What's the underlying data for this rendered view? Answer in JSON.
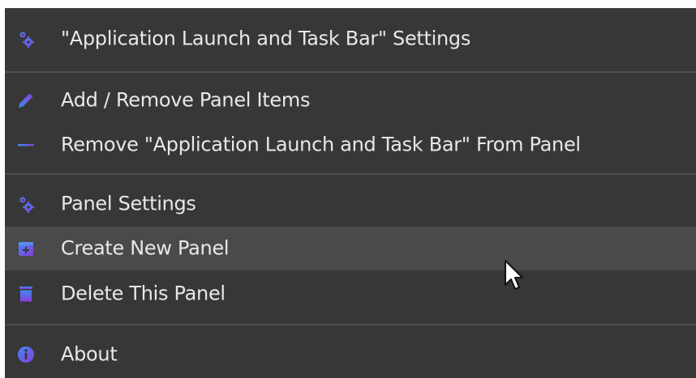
{
  "menu": {
    "items": [
      {
        "label": "\"Application Launch and Task Bar\" Settings",
        "icon": "gear-settings-icon"
      },
      {
        "label": "Add / Remove Panel Items",
        "icon": "pencil-icon"
      },
      {
        "label": "Remove \"Application Launch and Task Bar\" From Panel",
        "icon": "minus-icon"
      },
      {
        "label": "Panel Settings",
        "icon": "gear-settings-icon"
      },
      {
        "label": "Create New Panel",
        "icon": "new-panel-icon",
        "highlighted": true
      },
      {
        "label": "Delete This Panel",
        "icon": "trash-icon"
      },
      {
        "label": "About",
        "icon": "info-icon"
      }
    ]
  },
  "colors": {
    "menu_background": "#373737",
    "hover_background": "#4a4a4a",
    "separator": "#4d4d4d",
    "text": "#e8e8e8",
    "icon_gradient_start": "#3c8cf0",
    "icon_gradient_end": "#8c3cdc"
  }
}
